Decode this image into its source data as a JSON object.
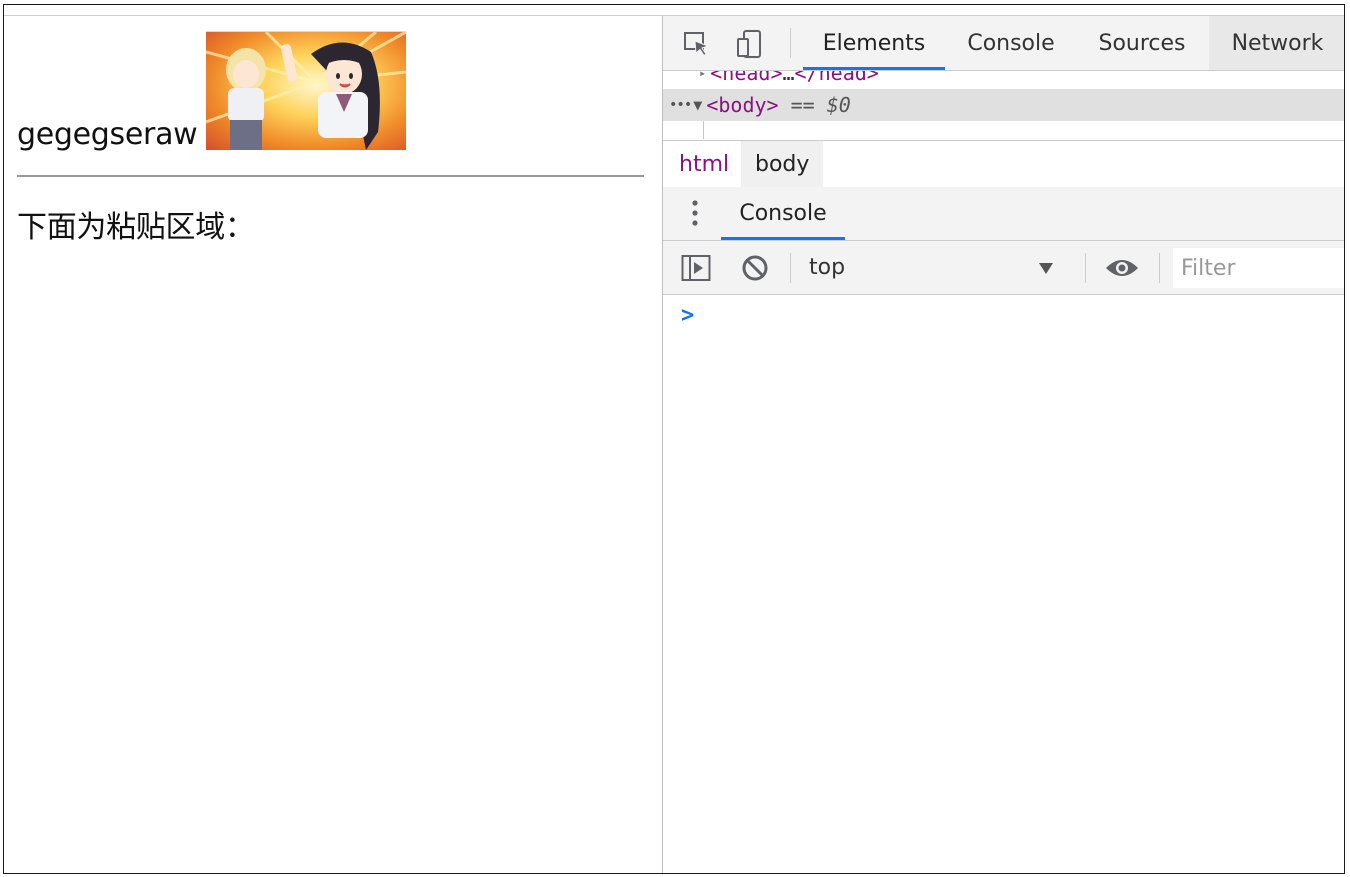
{
  "page": {
    "heading_text": "gegegseraw",
    "image_alt": "anime-gif",
    "paste_label": "下面为粘贴区域："
  },
  "devtools": {
    "tabs": [
      {
        "label": "Elements",
        "active": true
      },
      {
        "label": "Console",
        "active": false
      },
      {
        "label": "Sources",
        "active": false
      },
      {
        "label": "Network",
        "active": false
      }
    ],
    "icons": {
      "inspect": "inspect-element-icon",
      "device": "device-toolbar-icon",
      "menu": "kebab-menu-icon",
      "sidebar": "console-sidebar-icon",
      "clear": "clear-console-icon",
      "eye": "live-expression-eye-icon",
      "prompt": "console-prompt-icon"
    },
    "dom_tree": {
      "head_tag_open": "<head>",
      "head_ellipsis": "…",
      "head_tag_close": "</head>",
      "body_tag_open": "<body>",
      "body_marker": "== $0",
      "row_ellipsis": "•••"
    },
    "breadcrumbs": [
      "html",
      "body"
    ],
    "drawer": {
      "tab_label": "Console"
    },
    "console": {
      "context": "top",
      "filter_placeholder": "Filter",
      "prompt": ">"
    },
    "colors": {
      "accent": "#1a73e8",
      "tag": "#881280",
      "toolbar_bg": "#f3f3f3",
      "selected_row": "#e0e0e0"
    }
  }
}
